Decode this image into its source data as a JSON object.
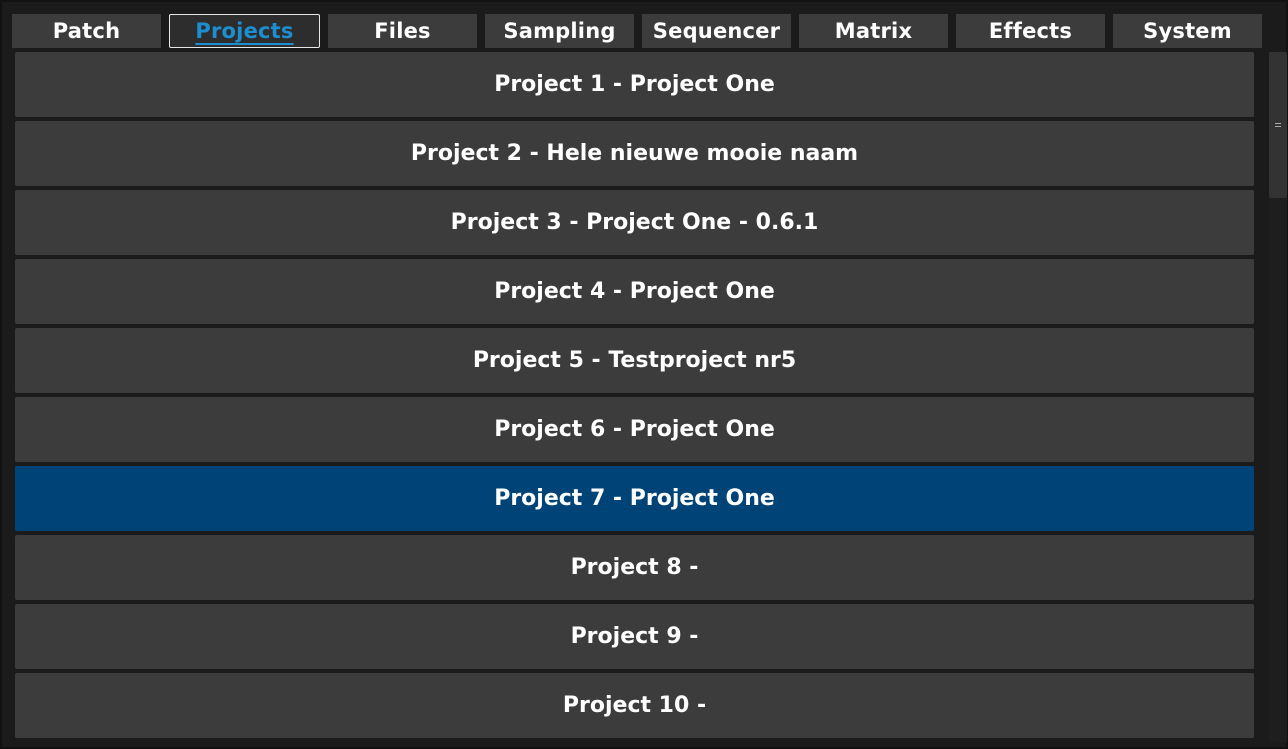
{
  "tabs": [
    {
      "label": "Patch",
      "active": false
    },
    {
      "label": "Projects",
      "active": true
    },
    {
      "label": "Files",
      "active": false
    },
    {
      "label": "Sampling",
      "active": false
    },
    {
      "label": "Sequencer",
      "active": false
    },
    {
      "label": "Matrix",
      "active": false
    },
    {
      "label": "Effects",
      "active": false
    },
    {
      "label": "System",
      "active": false
    }
  ],
  "projects": [
    {
      "label": "Project 1 - Project One",
      "selected": false
    },
    {
      "label": "Project 2 - Hele nieuwe mooie naam",
      "selected": false
    },
    {
      "label": "Project 3 - Project One - 0.6.1",
      "selected": false
    },
    {
      "label": "Project 4 - Project One",
      "selected": false
    },
    {
      "label": "Project 5 - Testproject nr5",
      "selected": false
    },
    {
      "label": "Project 6 - Project One",
      "selected": false
    },
    {
      "label": "Project 7 - Project One",
      "selected": true
    },
    {
      "label": "Project 8 -",
      "selected": false
    },
    {
      "label": "Project 9 -",
      "selected": false
    },
    {
      "label": "Project 10 -",
      "selected": false
    }
  ],
  "colors": {
    "background": "#1b1b1b",
    "row": "#3c3c3c",
    "selected_row": "#004477",
    "active_tab_text": "#1d8fd0",
    "text": "#ffffff"
  },
  "icons": {
    "scroll_grip": "grip-lines-icon"
  }
}
